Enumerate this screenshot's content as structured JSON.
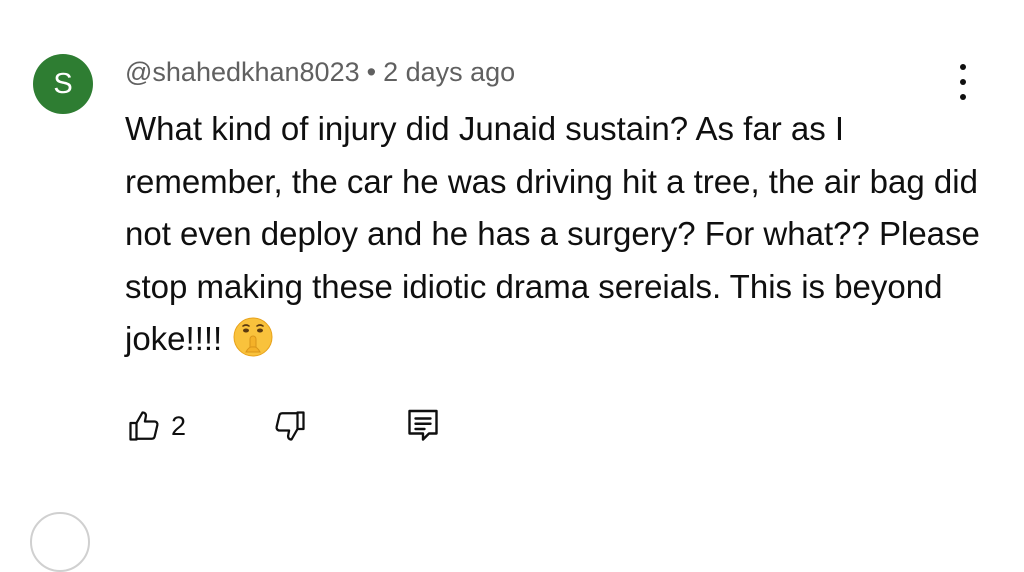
{
  "comment": {
    "avatar_letter": "S",
    "avatar_color": "#2e7d32",
    "author": "@shahedkhan8023",
    "separator": "•",
    "time": "2 days ago",
    "text": "What kind of injury did Junaid sustain? As far as I remember, the car he was driving hit a tree, the air bag did not even deploy and he has a surgery? For what?? Please stop making these idiotic drama sereials. This is beyond joke!!!!",
    "emoji": "shushing-face",
    "like_count": "2"
  },
  "icons": {
    "more": "more-vert-icon",
    "like": "thumb-up-icon",
    "dislike": "thumb-down-icon",
    "reply": "reply-comment-icon"
  }
}
